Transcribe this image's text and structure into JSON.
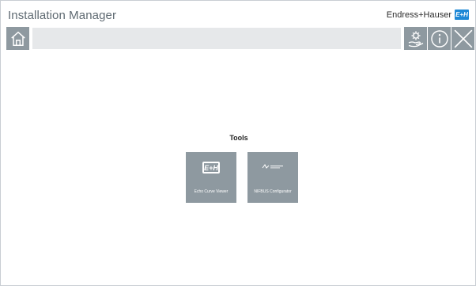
{
  "app": {
    "title": "Installation Manager",
    "brand": "Endress+Hauser",
    "brand_logo": "E+H"
  },
  "toolbar": {
    "home_icon": "home-icon",
    "settings_icon": "settings-hand-icon",
    "info_icon": "info-icon",
    "close_icon": "close-icon",
    "status_text": ""
  },
  "main": {
    "heading": "Tools",
    "tiles": [
      {
        "label": "Echo Curve Viewer",
        "icon": "eh-logo-icon",
        "logo_text": "E+H"
      },
      {
        "label": "NIFBUS Configurator",
        "icon": "national-instruments-logo-icon"
      }
    ]
  },
  "colors": {
    "toolbar_button": "#8e99a0",
    "status_bar": "#e6e8ea",
    "title_text": "#5f6a72",
    "brand_blue": "#1e88d6"
  }
}
